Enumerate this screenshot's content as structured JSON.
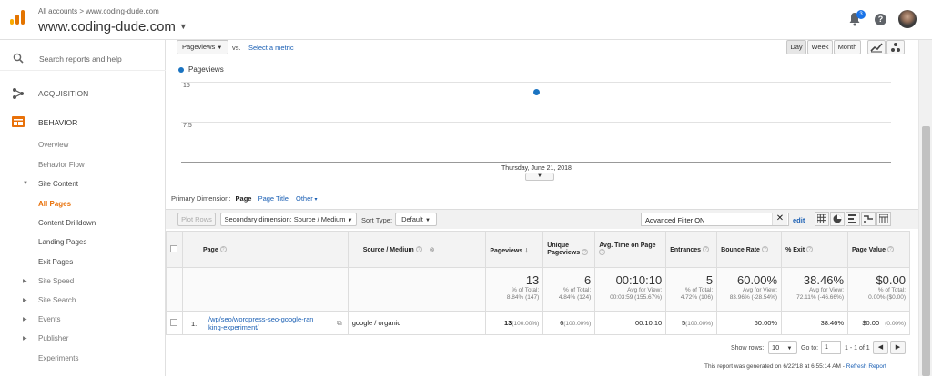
{
  "header": {
    "breadcrumb": "All accounts > www.coding-dude.com",
    "property": "www.coding-dude.com",
    "notification_count": "3",
    "help_symbol": "?",
    "logo_colors": [
      "#f9ab00",
      "#e37400",
      "#e37400"
    ]
  },
  "sidebar": {
    "search_placeholder": "Search reports and help",
    "acquisition": "ACQUISITION",
    "behavior": "BEHAVIOR",
    "items": [
      {
        "label": "Overview"
      },
      {
        "label": "Behavior Flow"
      },
      {
        "label": "Site Content"
      },
      {
        "label": "All Pages"
      },
      {
        "label": "Content Drilldown"
      },
      {
        "label": "Landing Pages"
      },
      {
        "label": "Exit Pages"
      },
      {
        "label": "Site Speed"
      },
      {
        "label": "Site Search"
      },
      {
        "label": "Events"
      },
      {
        "label": "Publisher"
      },
      {
        "label": "Experiments"
      }
    ]
  },
  "controls": {
    "metric": "Pageviews",
    "vs": "vs.",
    "select_metric": "Select a metric",
    "day": "Day",
    "week": "Week",
    "month": "Month"
  },
  "chart_data": {
    "type": "scatter",
    "series": [
      {
        "name": "Pageviews",
        "values": [
          13
        ]
      }
    ],
    "x": [
      "Thursday, June 21, 2018"
    ],
    "yticks": [
      "15",
      "7.5"
    ],
    "ylim": [
      0,
      15
    ],
    "point_color": "#1a73c1"
  },
  "dimension": {
    "label": "Primary Dimension:",
    "page": "Page",
    "page_title": "Page Title",
    "other": "Other"
  },
  "toolbar": {
    "plot_rows": "Plot Rows",
    "secondary": "Secondary dimension: Source / Medium",
    "sort_type_label": "Sort Type:",
    "sort_type": "Default",
    "filter": "Advanced Filter ON",
    "edit": "edit"
  },
  "table": {
    "headers": [
      "Page",
      "Source / Medium",
      "Pageviews",
      "Unique Pageviews",
      "Avg. Time on Page",
      "Entrances",
      "Bounce Rate",
      "% Exit",
      "Page Value"
    ],
    "totals": [
      {
        "big": "13",
        "s1": "% of Total:",
        "s2": "8.84% (147)"
      },
      {
        "big": "6",
        "s1": "% of Total:",
        "s2": "4.84% (124)"
      },
      {
        "big": "00:10:10",
        "s1": "Avg for View:",
        "s2": "00:03:59 (155.67%)"
      },
      {
        "big": "5",
        "s1": "% of Total:",
        "s2": "4.72% (106)"
      },
      {
        "big": "60.00%",
        "s1": "Avg for View:",
        "s2": "83.96% (-28.54%)"
      },
      {
        "big": "38.46%",
        "s1": "Avg for View:",
        "s2": "72.11% (-46.66%)"
      },
      {
        "big": "$0.00",
        "s1": "% of Total:",
        "s2": "0.00% ($0.00)"
      }
    ],
    "row": {
      "index": "1.",
      "page_l1": "/wp/seo/wordpress-seo-google-ran",
      "page_l2": "king-experiment/",
      "source": "google / organic",
      "pageviews": "13",
      "pageviews_pct": "(100.00%)",
      "unique": "6",
      "unique_pct": "(100.00%)",
      "avg_time": "00:10:10",
      "entrances": "5",
      "entrances_pct": "(100.00%)",
      "bounce": "60.00%",
      "exit": "38.46%",
      "value": "$0.00",
      "value_pct": "(0.00%)"
    }
  },
  "footer": {
    "show_rows": "Show rows:",
    "rows_value": "10",
    "goto": "Go to:",
    "goto_value": "1",
    "range": "1 - 1 of 1",
    "generated": "This report was generated on 6/22/18 at 6:55:14 AM -",
    "refresh": "Refresh Report"
  }
}
